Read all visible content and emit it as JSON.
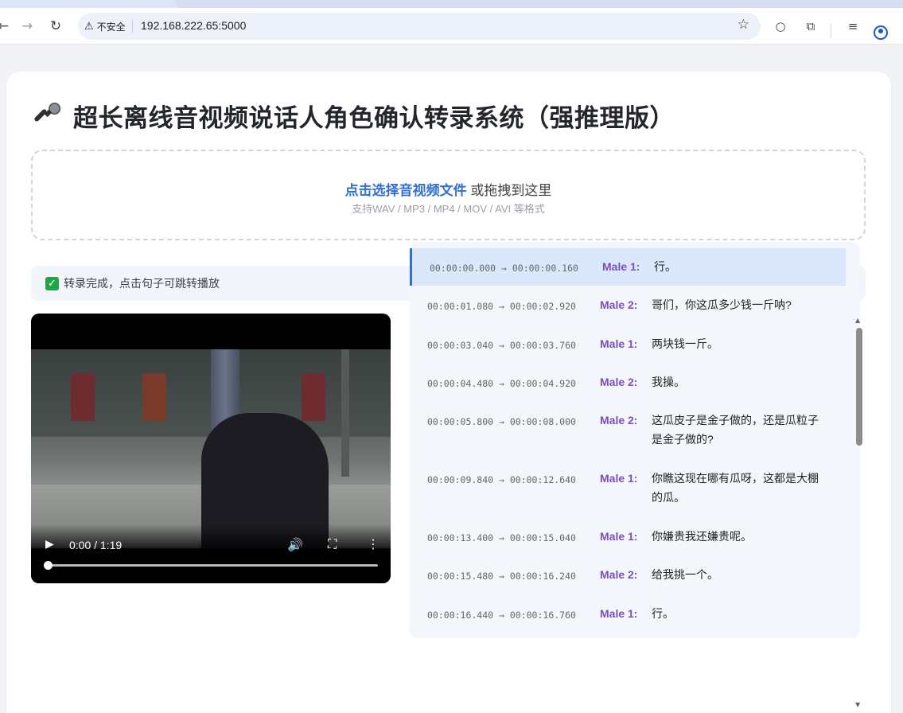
{
  "browser": {
    "security_label": "不安全",
    "url": "192.168.222.65:5000"
  },
  "page": {
    "title": "超长离线音视频说话人角色确认转录系统（强推理版）",
    "dropzone": {
      "pick_label": "点击选择音视频文件",
      "rest_label": " 或拖拽到这里",
      "formats": "支持WAV / MP3 / MP4 / MOV / AVI 等格式"
    },
    "status_text": "转录完成，点击句子可跳转播放",
    "player": {
      "time": "0:00 / 1:19",
      "progress": 0
    },
    "segments": [
      {
        "ts": "00:00:00.000 → 00:00:00.160",
        "speaker": "Male 1:",
        "text": "行。",
        "active": true
      },
      {
        "ts": "00:00:01.080 → 00:00:02.920",
        "speaker": "Male 2:",
        "text": "哥们，你这瓜多少钱一斤呐?"
      },
      {
        "ts": "00:00:03.040 → 00:00:03.760",
        "speaker": "Male 1:",
        "text": "两块钱一斤。"
      },
      {
        "ts": "00:00:04.480 → 00:00:04.920",
        "speaker": "Male 2:",
        "text": "我操。"
      },
      {
        "ts": "00:00:05.800 → 00:00:08.000",
        "speaker": "Male 2:",
        "text": "这瓜皮子是金子做的，还是瓜粒子是金子做的?"
      },
      {
        "ts": "00:00:09.840 → 00:00:12.640",
        "speaker": "Male 1:",
        "text": "你瞧这现在哪有瓜呀，这都是大棚的瓜。"
      },
      {
        "ts": "00:00:13.400 → 00:00:15.040",
        "speaker": "Male 1:",
        "text": "你嫌贵我还嫌贵呢。"
      },
      {
        "ts": "00:00:15.480 → 00:00:16.240",
        "speaker": "Male 2:",
        "text": "给我挑一个。"
      },
      {
        "ts": "00:00:16.440 → 00:00:16.760",
        "speaker": "Male 1:",
        "text": "行。"
      }
    ],
    "colors": {
      "accent": "#2f6fd6",
      "speaker": "#7a4fc0",
      "active_row": "#dbe8fb",
      "success": "#22a447"
    }
  }
}
